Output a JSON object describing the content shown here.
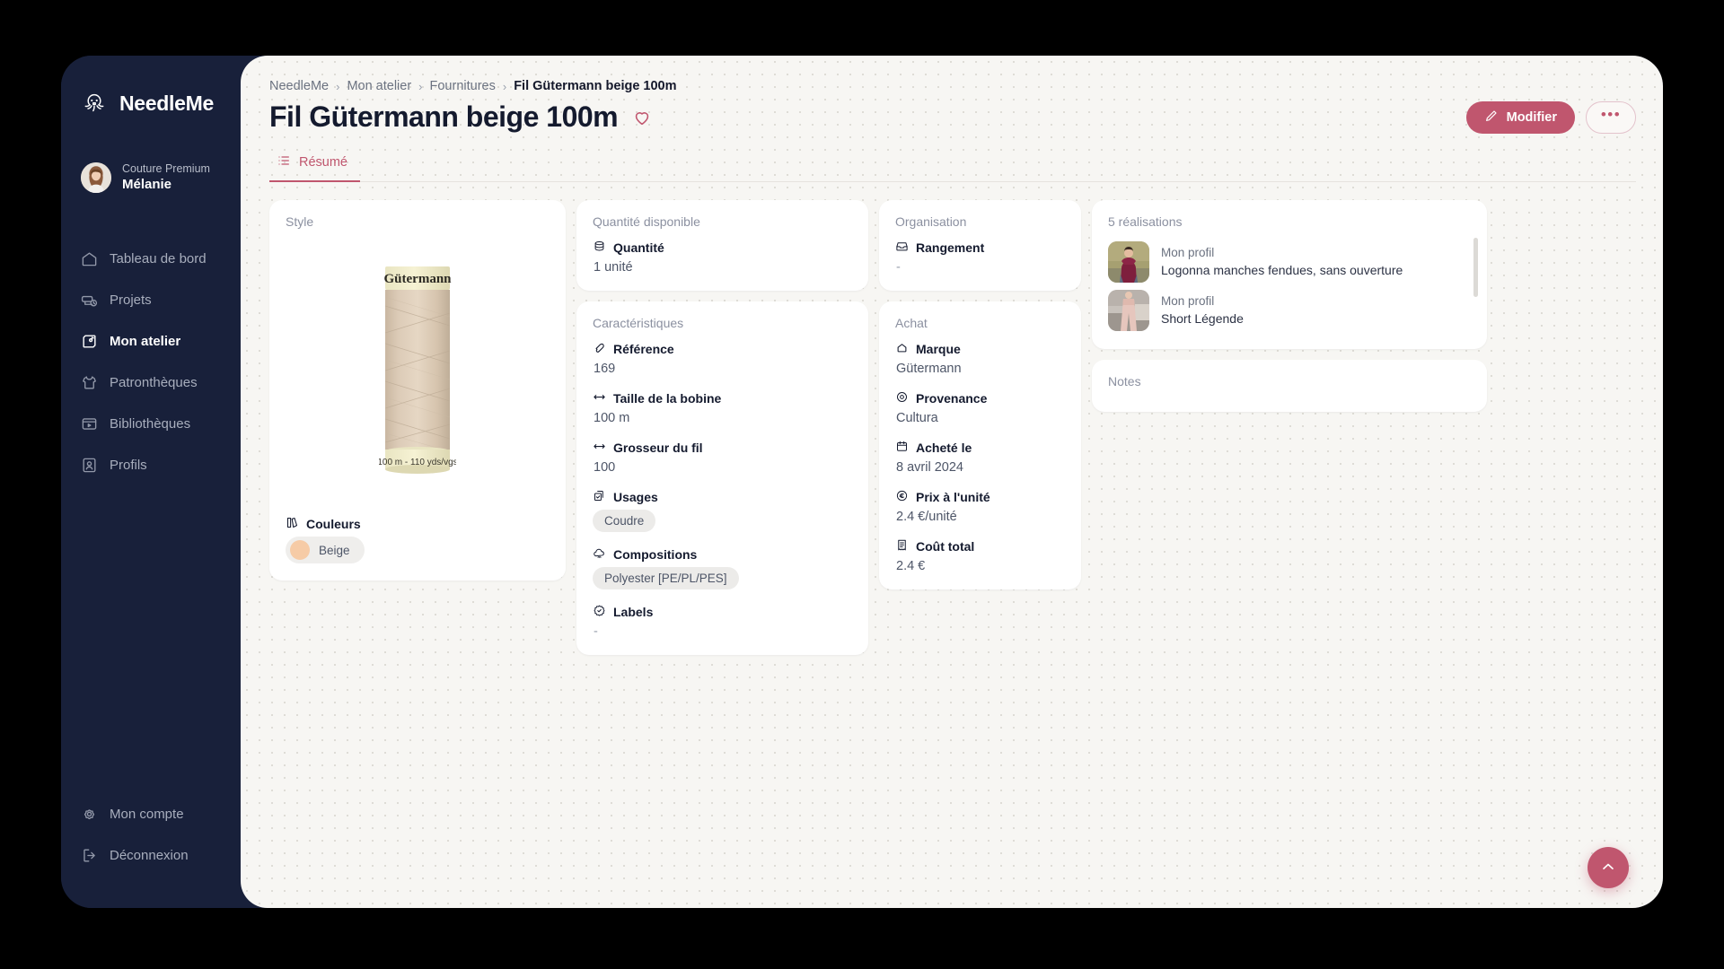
{
  "app": {
    "brand": "NeedleMe",
    "logo_icon": "octopus-icon"
  },
  "sidebar": {
    "user": {
      "plan": "Couture Premium",
      "name": "Mélanie"
    },
    "items": [
      {
        "label": "Tableau de bord",
        "icon": "home-icon",
        "active": false
      },
      {
        "label": "Projets",
        "icon": "sewing-machine-icon",
        "active": false
      },
      {
        "label": "Mon atelier",
        "icon": "workshop-icon",
        "active": true
      },
      {
        "label": "Patronthèques",
        "icon": "tshirt-icon",
        "active": false
      },
      {
        "label": "Bibliothèques",
        "icon": "library-icon",
        "active": false
      },
      {
        "label": "Profils",
        "icon": "user-card-icon",
        "active": false
      }
    ],
    "bottom_items": [
      {
        "label": "Mon compte",
        "icon": "gear-icon"
      },
      {
        "label": "Déconnexion",
        "icon": "logout-icon"
      }
    ]
  },
  "header": {
    "breadcrumb": [
      "NeedleMe",
      "Mon atelier",
      "Fournitures",
      "Fil Gütermann beige 100m"
    ],
    "separator": "›",
    "title": "Fil Gütermann beige 100m",
    "favorite_icon": "heart-icon",
    "edit_label": "Modifier",
    "edit_icon": "pencil-icon",
    "more_label": "•••"
  },
  "tabs": [
    {
      "label": "Résumé",
      "icon": "list-icon",
      "active": true
    }
  ],
  "style_card": {
    "label": "Style",
    "image_alt": "Bobine Gütermann beige",
    "spool_brand": "Gütermann",
    "spool_footer": "100 m - 110 yds/vgs",
    "colors_label": "Couleurs",
    "colors_icon": "palette-icon",
    "color_name": "Beige",
    "color_hex": "#f6cba6"
  },
  "quantity_card": {
    "label": "Quantité disponible",
    "field_label": "Quantité",
    "field_icon": "stack-icon",
    "value": "1 unité"
  },
  "characteristics_card": {
    "label": "Caractéristiques",
    "fields": [
      {
        "label": "Référence",
        "icon": "tag-icon",
        "value": "169",
        "type": "text"
      },
      {
        "label": "Taille de la bobine",
        "icon": "arrows-horizontal-icon",
        "value": "100 m",
        "type": "text"
      },
      {
        "label": "Grosseur du fil",
        "icon": "arrows-horizontal-icon",
        "value": "100",
        "type": "text"
      },
      {
        "label": "Usages",
        "icon": "copy-check-icon",
        "value": "Coudre",
        "type": "chip"
      },
      {
        "label": "Compositions",
        "icon": "cloud-icon",
        "value": "Polyester [PE/PL/PES]",
        "type": "chip"
      },
      {
        "label": "Labels",
        "icon": "badge-check-icon",
        "value": "-",
        "type": "dash"
      }
    ]
  },
  "organisation_card": {
    "label": "Organisation",
    "field_label": "Rangement",
    "field_icon": "box-icon",
    "value": "-"
  },
  "purchase_card": {
    "label": "Achat",
    "fields": [
      {
        "label": "Marque",
        "icon": "brand-icon",
        "value": "Gütermann"
      },
      {
        "label": "Provenance",
        "icon": "pin-icon",
        "value": "Cultura"
      },
      {
        "label": "Acheté le",
        "icon": "calendar-icon",
        "value": "8 avril 2024"
      },
      {
        "label": "Prix à l'unité",
        "icon": "euro-icon",
        "value": "2.4 €/unité"
      },
      {
        "label": "Coût total",
        "icon": "receipt-icon",
        "value": "2.4 €"
      }
    ]
  },
  "realisations_card": {
    "label": "5 réalisations",
    "items": [
      {
        "profile": "Mon profil",
        "name": "Logonna manches fendues, sans ouverture",
        "thumb": "burgundy-top"
      },
      {
        "profile": "Mon profil",
        "name": "Short Légende",
        "thumb": "pink-pants"
      }
    ]
  },
  "notes_card": {
    "label": "Notes"
  },
  "fab": {
    "icon": "chevron-up-icon"
  },
  "colors": {
    "accent": "#c0566e",
    "sidebar_bg": "#18203a",
    "main_bg": "#f7f6f3"
  }
}
